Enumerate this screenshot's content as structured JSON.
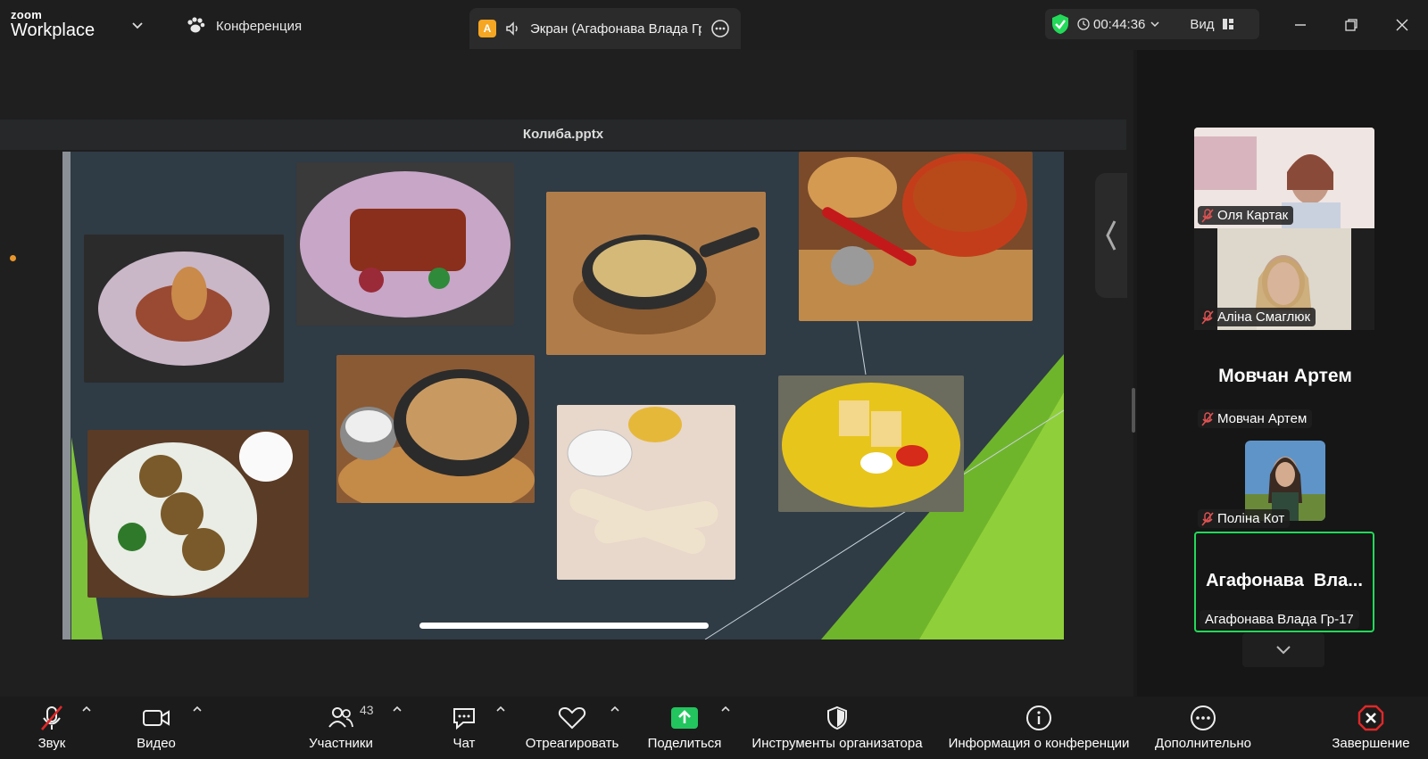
{
  "app": {
    "brand_top": "zoom",
    "brand_bottom": "Workplace",
    "meeting_label": "Конференция"
  },
  "share_tab": {
    "badge": "A",
    "title": "Экран (Агафонава Влада Гр-"
  },
  "status": {
    "timer": "00:44:36",
    "view_label": "Вид"
  },
  "slide": {
    "file_name": "Колиба.pptx"
  },
  "participants": [
    {
      "name": "Оля Картак"
    },
    {
      "name": "Аліна Смаглюк"
    },
    {
      "name": "Мовчан Артем",
      "display_name": "Мовчан Артем"
    },
    {
      "name": "Поліна Кот"
    },
    {
      "name": "Агафонава Влада Гр-17",
      "display_name": "Агафонава  Вла..."
    }
  ],
  "toolbar": {
    "audio": "Звук",
    "video": "Видео",
    "participants": "Участники",
    "participants_count": "43",
    "chat": "Чат",
    "react": "Отреагировать",
    "share": "Поделиться",
    "host_tools": "Инструменты организатора",
    "meeting_info": "Информация о конференции",
    "more": "Дополнительно",
    "end": "Завершение"
  },
  "colors": {
    "accent_green": "#23d959",
    "end_red": "#e02828",
    "share_green": "#22c55e"
  }
}
